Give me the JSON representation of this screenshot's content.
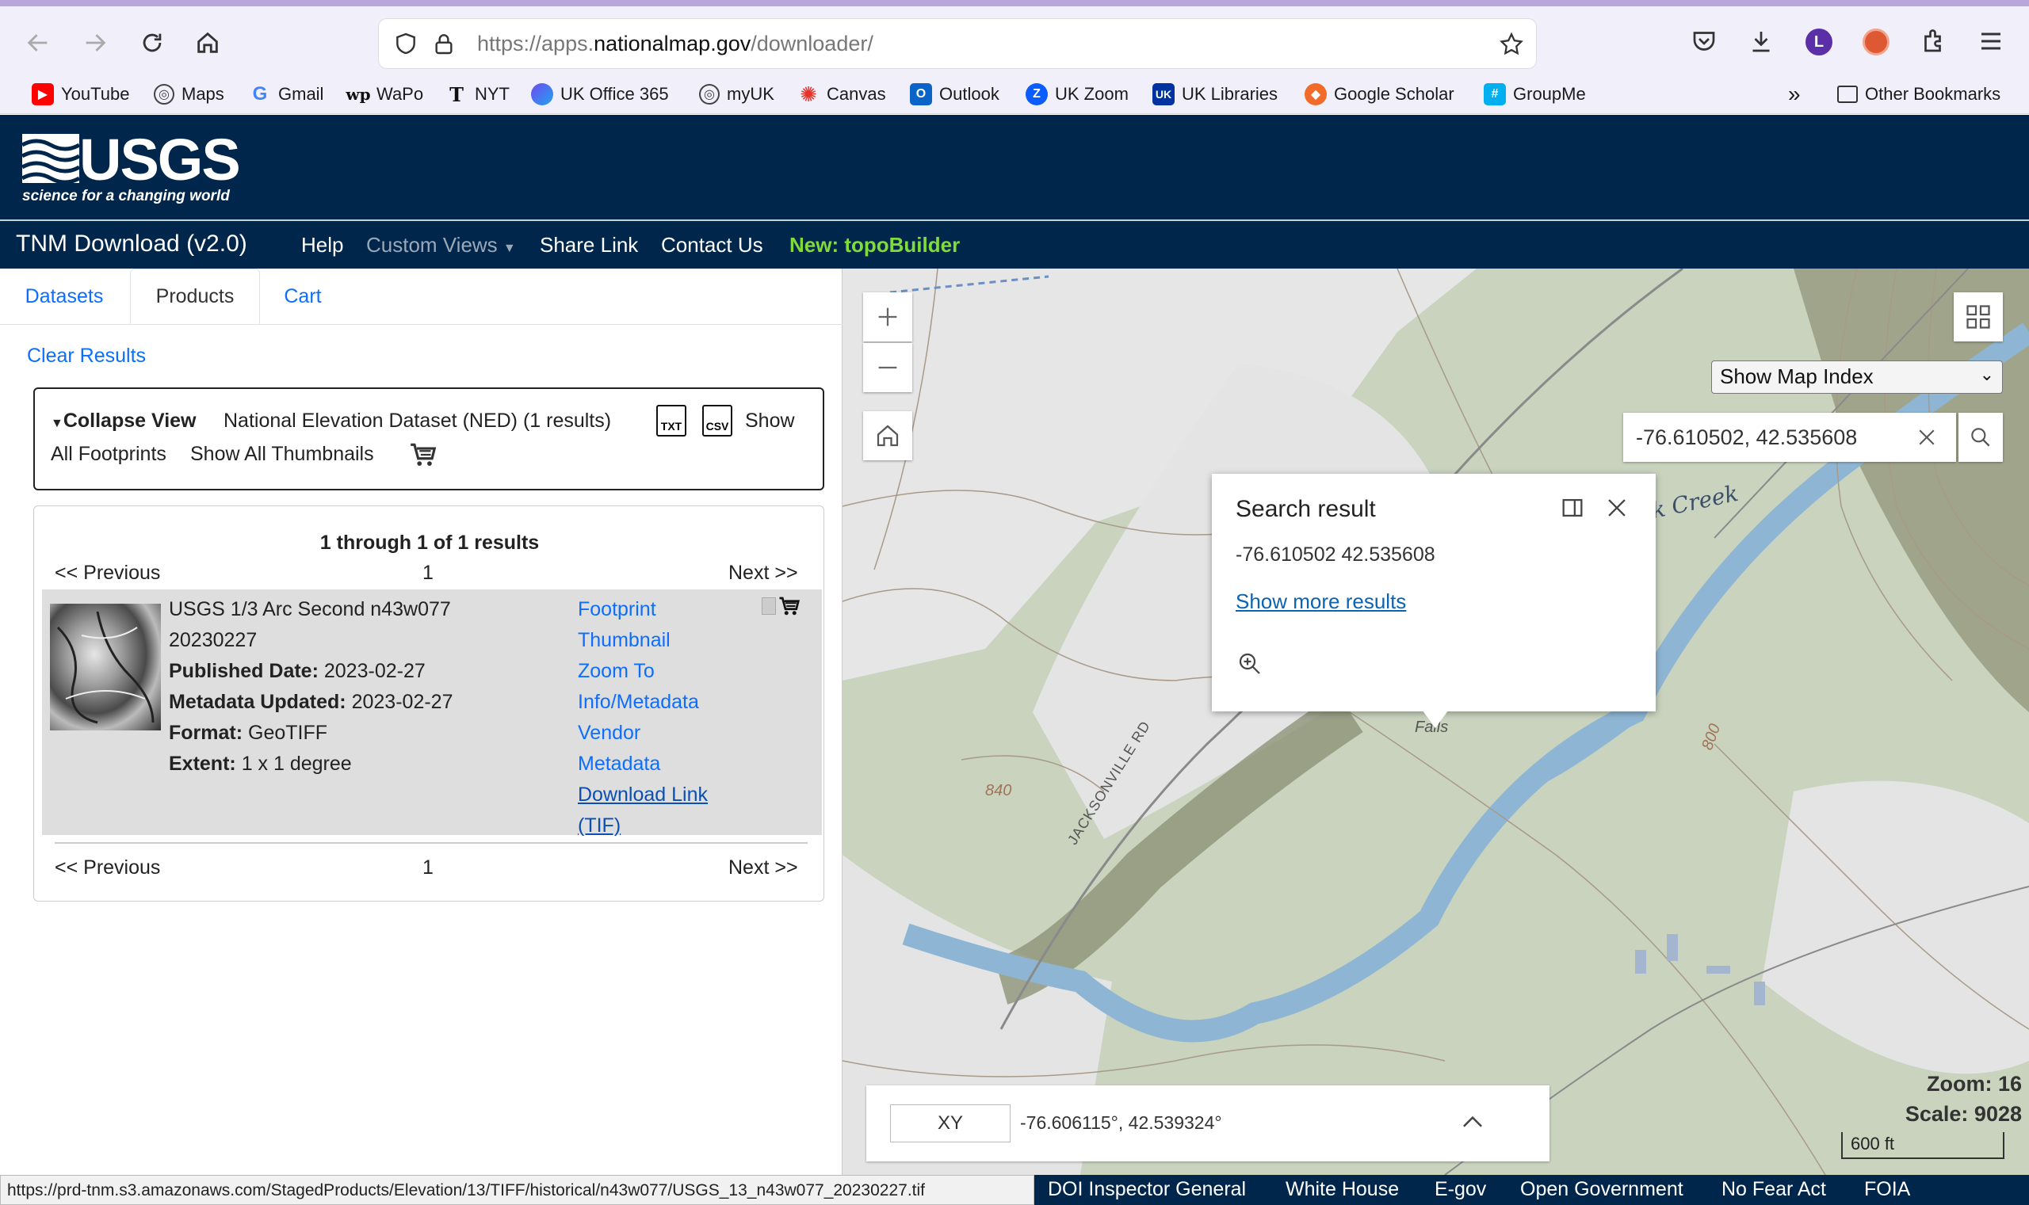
{
  "browser": {
    "url_prefix": "https://apps.",
    "url_host": "nationalmap.gov",
    "url_path": "/downloader/",
    "profile_initial": "L",
    "bookmarks": [
      {
        "label": "YouTube",
        "icon": "youtube-icon",
        "color": "#ff0000"
      },
      {
        "label": "Maps",
        "icon": "globe-icon",
        "color": "#444444"
      },
      {
        "label": "Gmail",
        "icon": "google-icon",
        "color": "#4285f4"
      },
      {
        "label": "WaPo",
        "icon": "wapo-icon",
        "color": "#111111"
      },
      {
        "label": "NYT",
        "icon": "nyt-icon",
        "color": "#111111"
      },
      {
        "label": "UK Office 365",
        "icon": "office-icon",
        "color": "#5b6bf5"
      },
      {
        "label": "myUK",
        "icon": "globe-icon",
        "color": "#444444"
      },
      {
        "label": "Canvas",
        "icon": "canvas-icon",
        "color": "#e4332b"
      },
      {
        "label": "Outlook",
        "icon": "outlook-icon",
        "color": "#0a64c8"
      },
      {
        "label": "UK Zoom",
        "icon": "zoom-icon",
        "color": "#0b5cff"
      },
      {
        "label": "UK Libraries",
        "icon": "uk-icon",
        "color": "#0033a0"
      },
      {
        "label": "Google Scholar",
        "icon": "scholar-icon",
        "color": "#f16a2a"
      },
      {
        "label": "GroupMe",
        "icon": "groupme-icon",
        "color": "#00aff0"
      }
    ],
    "other_bookmarks": "Other Bookmarks"
  },
  "header": {
    "logo_text": "USGS",
    "logo_tagline": "science for a changing world"
  },
  "navbar": {
    "title": "TNM Download (v2.0)",
    "help": "Help",
    "custom_views": "Custom Views",
    "share_link": "Share Link",
    "contact_us": "Contact Us",
    "new_topobuilder": "New: topoBuilder"
  },
  "tabs": {
    "datasets": "Datasets",
    "products": "Products",
    "cart": "Cart"
  },
  "left": {
    "clear_results": "Clear Results",
    "collapse_view": "Collapse View",
    "dataset_name": "National Elevation Dataset (NED) (1 results)",
    "txt_label": "TXT",
    "csv_label": "CSV",
    "show_all_footprints_1": "Show",
    "show_all_footprints_2": "All Footprints",
    "show_all_thumbnails": "Show All Thumbnails",
    "results_header": "1 through 1 of 1 results",
    "previous": "<< Previous",
    "page": "1",
    "next": "Next >>",
    "item": {
      "title_line1": "USGS 1/3 Arc Second n43w077",
      "title_line2": "20230227",
      "published_label": "Published Date:",
      "published_value": "2023-02-27",
      "metadata_label": "Metadata Updated:",
      "metadata_value": "2023-02-27",
      "format_label": "Format:",
      "format_value": "GeoTIFF",
      "extent_label": "Extent:",
      "extent_value": "1 x 1 degree",
      "links": [
        "Footprint",
        "Thumbnail",
        "Zoom To",
        "Info/Metadata",
        "Vendor",
        "Metadata"
      ],
      "download_1": "Download Link",
      "download_2": "(TIF)"
    }
  },
  "map": {
    "map_index_option": "Show Map Index",
    "search_value": "-76.610502, 42.535608",
    "popup_title": "Search result",
    "popup_coords": "-76.610502 42.535608",
    "popup_more": "Show more results",
    "labels": {
      "creek": "k Creek",
      "road": "JACKSONVILLE RD",
      "contour_840": "840",
      "contour_800": "800",
      "falls": "Falls"
    },
    "coord_mode": "XY",
    "coord_readout": "-76.606115°, 42.539324°",
    "zoom": "Zoom: 16",
    "scale": "Scale: 9028",
    "scale_bar": "600 ft"
  },
  "footer": {
    "status_url": "https://prd-tnm.s3.amazonaws.com/StagedProducts/Elevation/13/TIFF/historical/n43w077/USGS_13_n43w077_20230227.tif",
    "links": [
      "DOI Inspector General",
      "White House",
      "E-gov",
      "Open Government",
      "No Fear Act",
      "FOIA"
    ]
  },
  "colors": {
    "usgs_navy": "#00264c",
    "link_blue": "#0d6efd",
    "topobuilder_green": "#7fdc3b",
    "water": "#8eb6d4"
  }
}
